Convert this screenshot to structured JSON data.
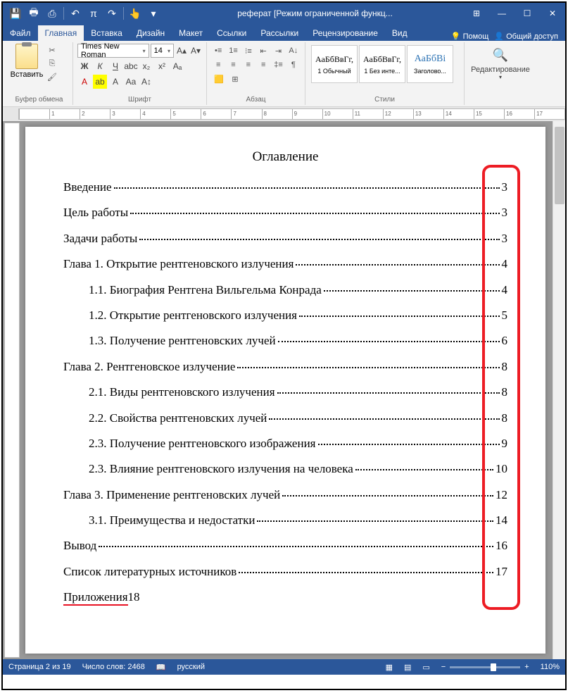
{
  "title": "реферат [Режим ограниченной функц...",
  "tabs": {
    "file": "Файл",
    "home": "Главная",
    "insert": "Вставка",
    "design": "Дизайн",
    "layout": "Макет",
    "refs": "Ссылки",
    "mail": "Рассылки",
    "review": "Рецензирование",
    "view": "Вид",
    "help": "Помощ",
    "share": "Общий доступ"
  },
  "ribbon": {
    "paste": "Вставить",
    "clipboard_label": "Буфер обмена",
    "font_name": "Times New Roman",
    "font_size": "14",
    "font_label": "Шрифт",
    "para_label": "Абзац",
    "styles": [
      {
        "sample": "АаБбВвГг,",
        "name": "1 Обычный"
      },
      {
        "sample": "АаБбВвГг,",
        "name": "1 Без инте..."
      },
      {
        "sample": "АаБбВі",
        "name": "Заголово..."
      }
    ],
    "styles_label": "Стили",
    "edit": "Редактирование"
  },
  "doc": {
    "title": "Оглавление",
    "toc": [
      {
        "t": "Введение",
        "p": "3",
        "i": 0
      },
      {
        "t": "Цель работы",
        "p": "3",
        "i": 0
      },
      {
        "t": "Задачи работы",
        "p": "3",
        "i": 0
      },
      {
        "t": "Глава 1. Открытие рентгеновского излучения",
        "p": "4",
        "i": 0
      },
      {
        "t": "1.1. Биография Рентгена Вильгельма Конрада",
        "p": "4",
        "i": 1
      },
      {
        "t": "1.2. Открытие рентгеновского излучения",
        "p": "5",
        "i": 1
      },
      {
        "t": "1.3. Получение рентгеновских лучей",
        "p": "6",
        "i": 1
      },
      {
        "t": "Глава 2. Рентгеновское излучение",
        "p": "8",
        "i": 0
      },
      {
        "t": "2.1. Виды рентгеновского излучения",
        "p": "8",
        "i": 1
      },
      {
        "t": "2.2. Свойства рентгеновских лучей",
        "p": "8",
        "i": 1
      },
      {
        "t": "2.3. Получение рентгеновского изображения",
        "p": "9",
        "i": 1
      },
      {
        "t": "2.3. Влияние рентгеновского излучения на человека",
        "p": "10",
        "i": 1
      },
      {
        "t": "Глава 3. Применение рентгеновских лучей",
        "p": "12",
        "i": 0
      },
      {
        "t": "3.1. Преимущества и недостатки",
        "p": "14",
        "i": 1
      },
      {
        "t": "Вывод",
        "p": "16",
        "i": 0
      },
      {
        "t": "Список литературных источников",
        "p": "17",
        "i": 0
      }
    ],
    "last": {
      "t": "Приложения",
      "p": "18"
    }
  },
  "status": {
    "page": "Страница 2 из 19",
    "words": "Число слов: 2468",
    "lang": "русский",
    "zoom": "110%"
  }
}
